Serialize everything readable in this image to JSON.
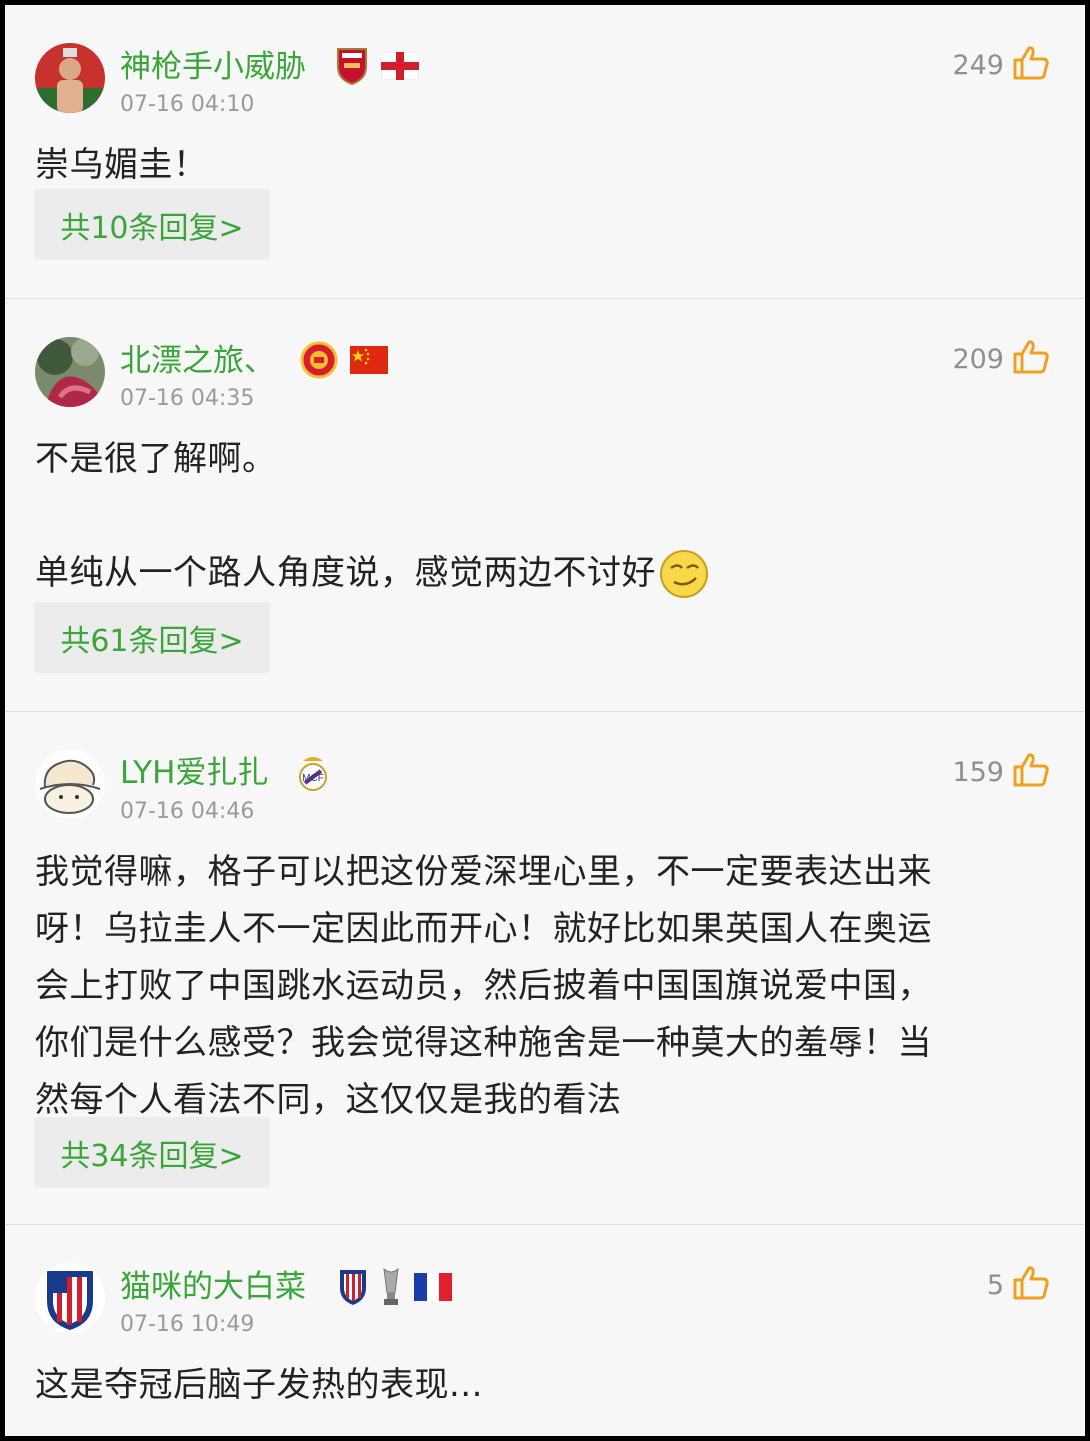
{
  "comments": [
    {
      "username": "神枪手小威胁",
      "time": "07-16 04:10",
      "likes": "249",
      "text": [
        "崇乌媚圭！"
      ],
      "replies": "共10条回复>",
      "badges": [
        "arsenal-crest-icon",
        "england-flag-icon"
      ]
    },
    {
      "username": "北漂之旅、",
      "time": "07-16 04:35",
      "likes": "209",
      "text": [
        "不是很了解啊。",
        "",
        "单纯从一个路人角度说，感觉两边不讨好"
      ],
      "replies": "共61条回复>",
      "badges": [
        "man-utd-crest-icon",
        "china-flag-icon"
      ]
    },
    {
      "username": "LYH爱扎扎",
      "time": "07-16 04:46",
      "likes": "159",
      "text": [
        "我觉得嘛，格子可以把这份爱深埋心里，不一定要表达出来",
        "呀！乌拉圭人不一定因此而开心！就好比如果英国人在奥运",
        "会上打败了中国跳水运动员，然后披着中国国旗说爱中国，",
        "你们是什么感受？我会觉得这种施舍是一种莫大的羞辱！当",
        "然每个人看法不同，这仅仅是我的看法"
      ],
      "replies": "共34条回复>",
      "badges": [
        "real-madrid-crest-icon"
      ]
    },
    {
      "username": "猫咪的大白菜",
      "time": "07-16 10:49",
      "likes": "5",
      "text": [
        "这是夺冠后脑子发热的表现..."
      ],
      "badges": [
        "atletico-crest-icon",
        "europa-trophy-icon",
        "france-flag-icon"
      ]
    }
  ],
  "colors": {
    "accent": "#3aa63a",
    "like_icon": "#f0a020",
    "background": "#f7f7f7"
  }
}
